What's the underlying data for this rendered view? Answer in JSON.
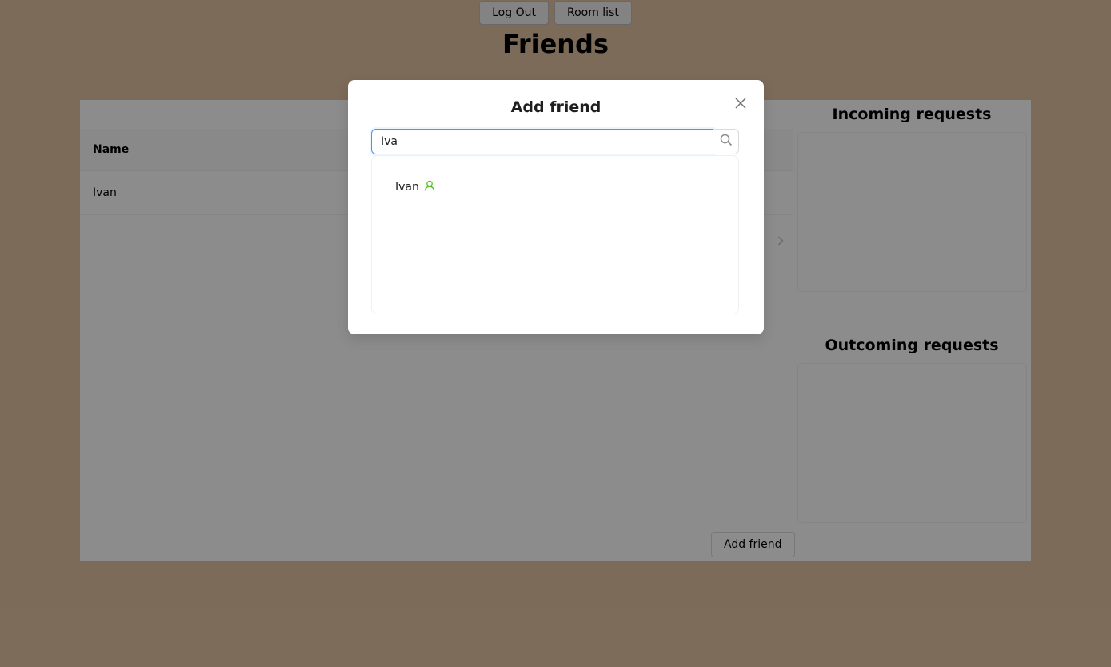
{
  "header": {
    "logout_label": "Log Out",
    "roomlist_label": "Room list",
    "page_title": "Friends"
  },
  "friends_table": {
    "column_name": "Name",
    "rows": [
      {
        "name": "Ivan"
      }
    ]
  },
  "add_friend_button": "Add friend",
  "incoming": {
    "title": "Incoming requests"
  },
  "outgoing": {
    "title": "Outcoming requests"
  },
  "modal": {
    "title": "Add friend",
    "search_value": "Iva",
    "results": [
      {
        "name": "Ivan",
        "icon": "user-icon"
      }
    ]
  },
  "colors": {
    "background": "#e2c4a2",
    "accent": "#4096ff",
    "user_icon": "#52c41a"
  }
}
